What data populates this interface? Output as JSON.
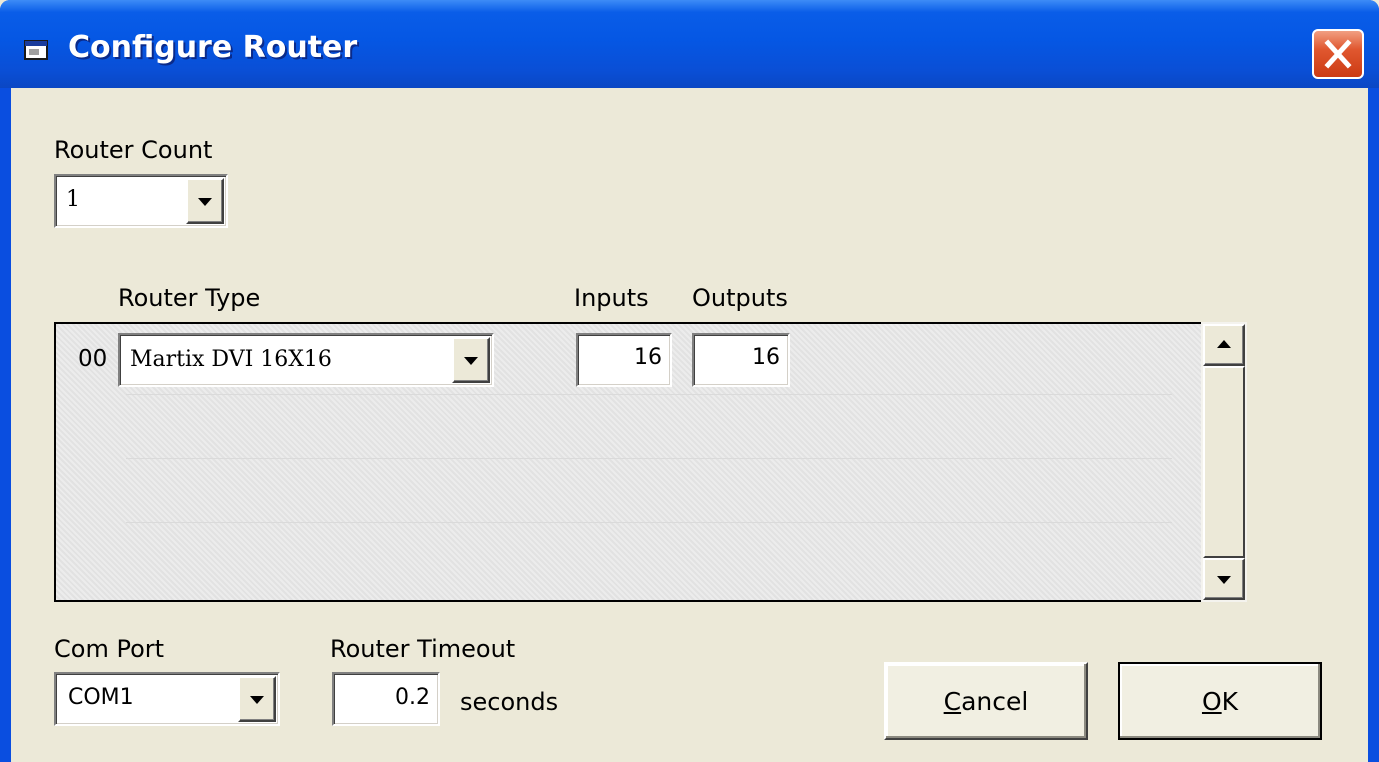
{
  "window": {
    "title": "Configure Router"
  },
  "router_count": {
    "label": "Router Count",
    "value": "1"
  },
  "columns": {
    "router_type": "Router Type",
    "inputs": "Inputs",
    "outputs": "Outputs"
  },
  "routers": [
    {
      "index": "00",
      "type": "Martix DVI 16X16",
      "inputs": "16",
      "outputs": "16"
    }
  ],
  "com_port": {
    "label": "Com Port",
    "value": "COM1"
  },
  "router_timeout": {
    "label": "Router Timeout",
    "value": "0.2",
    "unit": "seconds"
  },
  "buttons": {
    "cancel": {
      "prefix": "",
      "mnemonic": "C",
      "rest": "ancel"
    },
    "ok": {
      "prefix": "",
      "mnemonic": "O",
      "rest": "K"
    }
  },
  "icons": {
    "title": "window-app-icon",
    "close": "close-icon",
    "dropdown": "chevron-down-icon",
    "scroll_up": "scroll-up-arrow-icon",
    "scroll_down": "scroll-down-arrow-icon"
  },
  "colors": {
    "titlebar": "#0557e4",
    "dialog_bg": "#ece9d8",
    "close_button": "#e0572f"
  }
}
